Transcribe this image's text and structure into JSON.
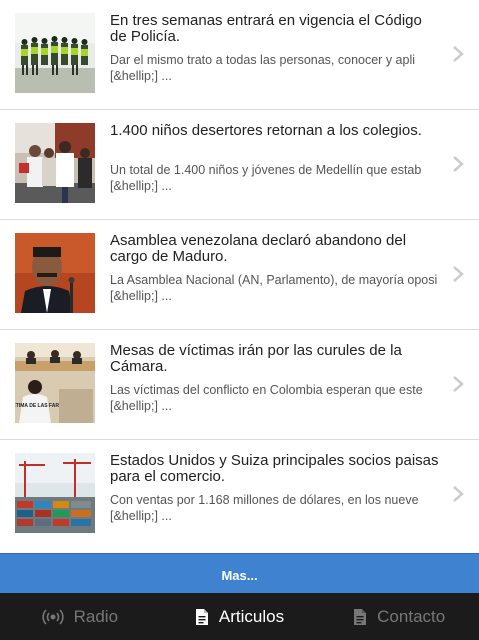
{
  "articles": [
    {
      "title": "En tres semanas entrará en vigencia el Código de Policía.",
      "excerpt": "Dar el mismo trato a todas las personas, conocer y apli [&hellip;] ...",
      "image": "police-formation-photo"
    },
    {
      "title": "1.400 niños desertores retornan a los colegios.",
      "excerpt": "Un total de 1.400 niños y jóvenes de Medellín que estab [&hellip;] ...",
      "image": "officials-greeting-photo"
    },
    {
      "title": "Asamblea venezolana declaró abandono del cargo de Maduro.",
      "excerpt": "La Asamblea Nacional (AN, Parlamento), de mayoría oposi [&hellip;] ...",
      "image": "maduro-speaking-photo"
    },
    {
      "title": "Mesas de víctimas irán por las curules de la Cámara.",
      "excerpt": "Las víctimas del conflicto en Colombia esperan que este [&hellip;] ...",
      "image": "victims-meeting-photo"
    },
    {
      "title": "Estados Unidos y Suiza principales socios paisas para el comercio.",
      "excerpt": "Con ventas por 1.168 millones de dólares, en los nueve [&hellip;] ...",
      "image": "shipping-port-photo"
    }
  ],
  "thumbnail_texts": {
    "shirt": "VÍCTIMA DE LAS FARC"
  },
  "more_button": {
    "label": "Mas..."
  },
  "tabs": [
    {
      "label": "Radio",
      "icon": "radio-broadcast-icon",
      "active": false
    },
    {
      "label": "Articulos",
      "icon": "document-icon",
      "active": true
    },
    {
      "label": "Contacto",
      "icon": "document-icon",
      "active": false
    }
  ],
  "colors": {
    "more_button_bg": "#3f83d0",
    "tabbar_bg": "#1b1b1b",
    "active_tab": "#ffffff",
    "inactive_tab": "#777777"
  }
}
